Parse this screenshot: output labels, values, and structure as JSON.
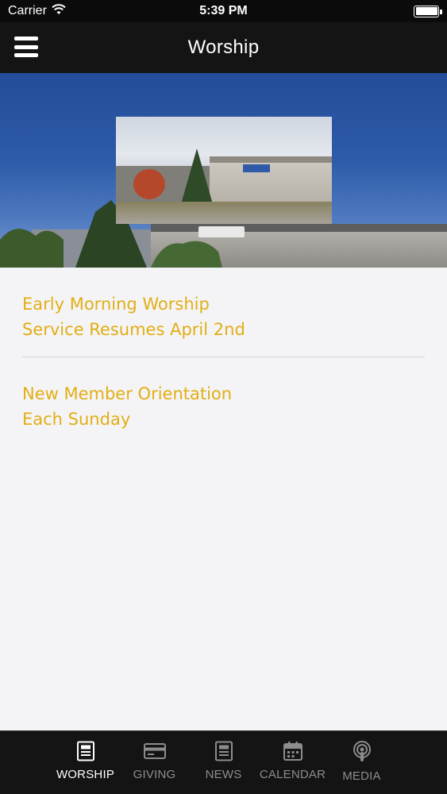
{
  "status_bar": {
    "carrier": "Carrier",
    "time": "5:39 PM"
  },
  "nav": {
    "title": "Worship"
  },
  "items": [
    {
      "title": "Early Morning Worship Service Resumes April 2nd"
    },
    {
      "title": "New Member Orientation Each Sunday"
    }
  ],
  "tabs": [
    {
      "label": "WORSHIP",
      "icon": "document-icon",
      "active": true
    },
    {
      "label": "GIVING",
      "icon": "credit-card-icon",
      "active": false
    },
    {
      "label": "NEWS",
      "icon": "newspaper-icon",
      "active": false
    },
    {
      "label": "CALENDAR",
      "icon": "calendar-icon",
      "active": false
    },
    {
      "label": "MEDIA",
      "icon": "podcast-icon",
      "active": false
    }
  ],
  "colors": {
    "accent": "#e2ae14",
    "bar_background": "#141414",
    "content_background": "#f4f4f6",
    "tab_inactive": "#8d8d8d",
    "tab_active": "#ffffff"
  }
}
